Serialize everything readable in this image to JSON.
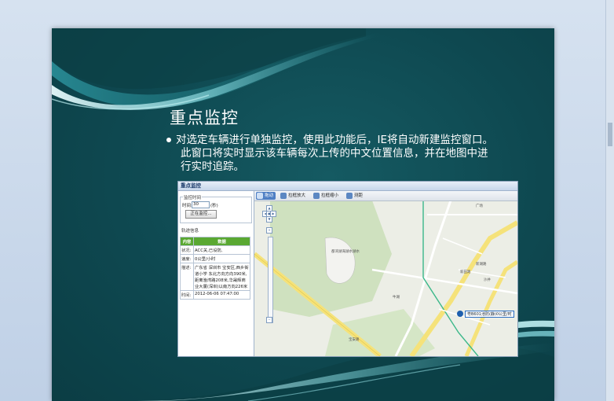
{
  "slide": {
    "title": "重点监控",
    "body_lines": [
      "对选定车辆进行单独监控，使用此功能后，IE将自动新建监控窗口。",
      "此窗口将实时显示该车辆每次上传的中文位置信息，并在地图中进",
      "行实时追踪。"
    ]
  },
  "embedded_screenshot": {
    "window_title": "重点监控",
    "monitor_group": {
      "label": "监控时间",
      "time_label": "时间:",
      "time_value": "30",
      "time_unit": "(秒)",
      "button_label": "正在监控..."
    },
    "track_group": {
      "label": "轨迹信息",
      "header_key": "内容",
      "header_value": "数据",
      "rows": [
        {
          "key": "状况:",
          "value": "ACC关,已设防,"
        },
        {
          "key": "速度:",
          "value": "0公里/小时"
        },
        {
          "key": "描述:",
          "value": "广东省 深圳市 宝安区,西乡街道小学 东北方向方向390米,距离渔湾路208米,华晟辉商业大厦(深圳)以南方向226米"
        },
        {
          "key": "时间:",
          "value": "2012-06-06 07:47:00"
        }
      ]
    },
    "map_toolbar": [
      {
        "label": "拖动",
        "active": true
      },
      {
        "label": "拉框放大",
        "active": false
      },
      {
        "label": "拉框缩小",
        "active": false
      },
      {
        "label": "测距",
        "active": false
      }
    ],
    "map_labels": {
      "park": "都湾湖海湖水湖水",
      "village": "牛湖",
      "road1": "宝安路",
      "road2": "新田路",
      "road3": "新湖路",
      "road4": "沙井",
      "road5": "广场"
    },
    "vehicle_tag": "粤B601池防(静)0公里/时"
  }
}
